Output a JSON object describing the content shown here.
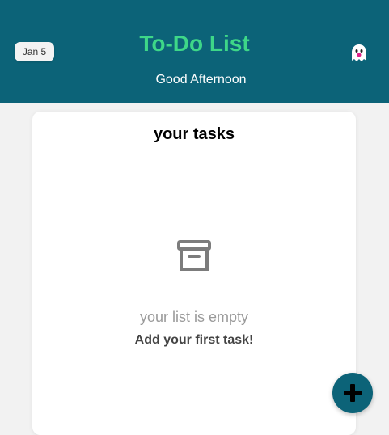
{
  "header": {
    "date": "Jan 5",
    "title": "To-Do List",
    "greeting": "Good Afternoon",
    "profile_icon": "ghost-icon"
  },
  "tasks_card": {
    "title": "your tasks",
    "empty_icon": "archive-icon",
    "empty_message": "your list is empty",
    "cta": "Add your first task!"
  },
  "fab": {
    "icon": "plus-icon"
  },
  "colors": {
    "header_bg": "#0c6378",
    "title": "#3ed788",
    "page_bg": "#f2f2f2",
    "muted_text": "#9a9a9a"
  }
}
